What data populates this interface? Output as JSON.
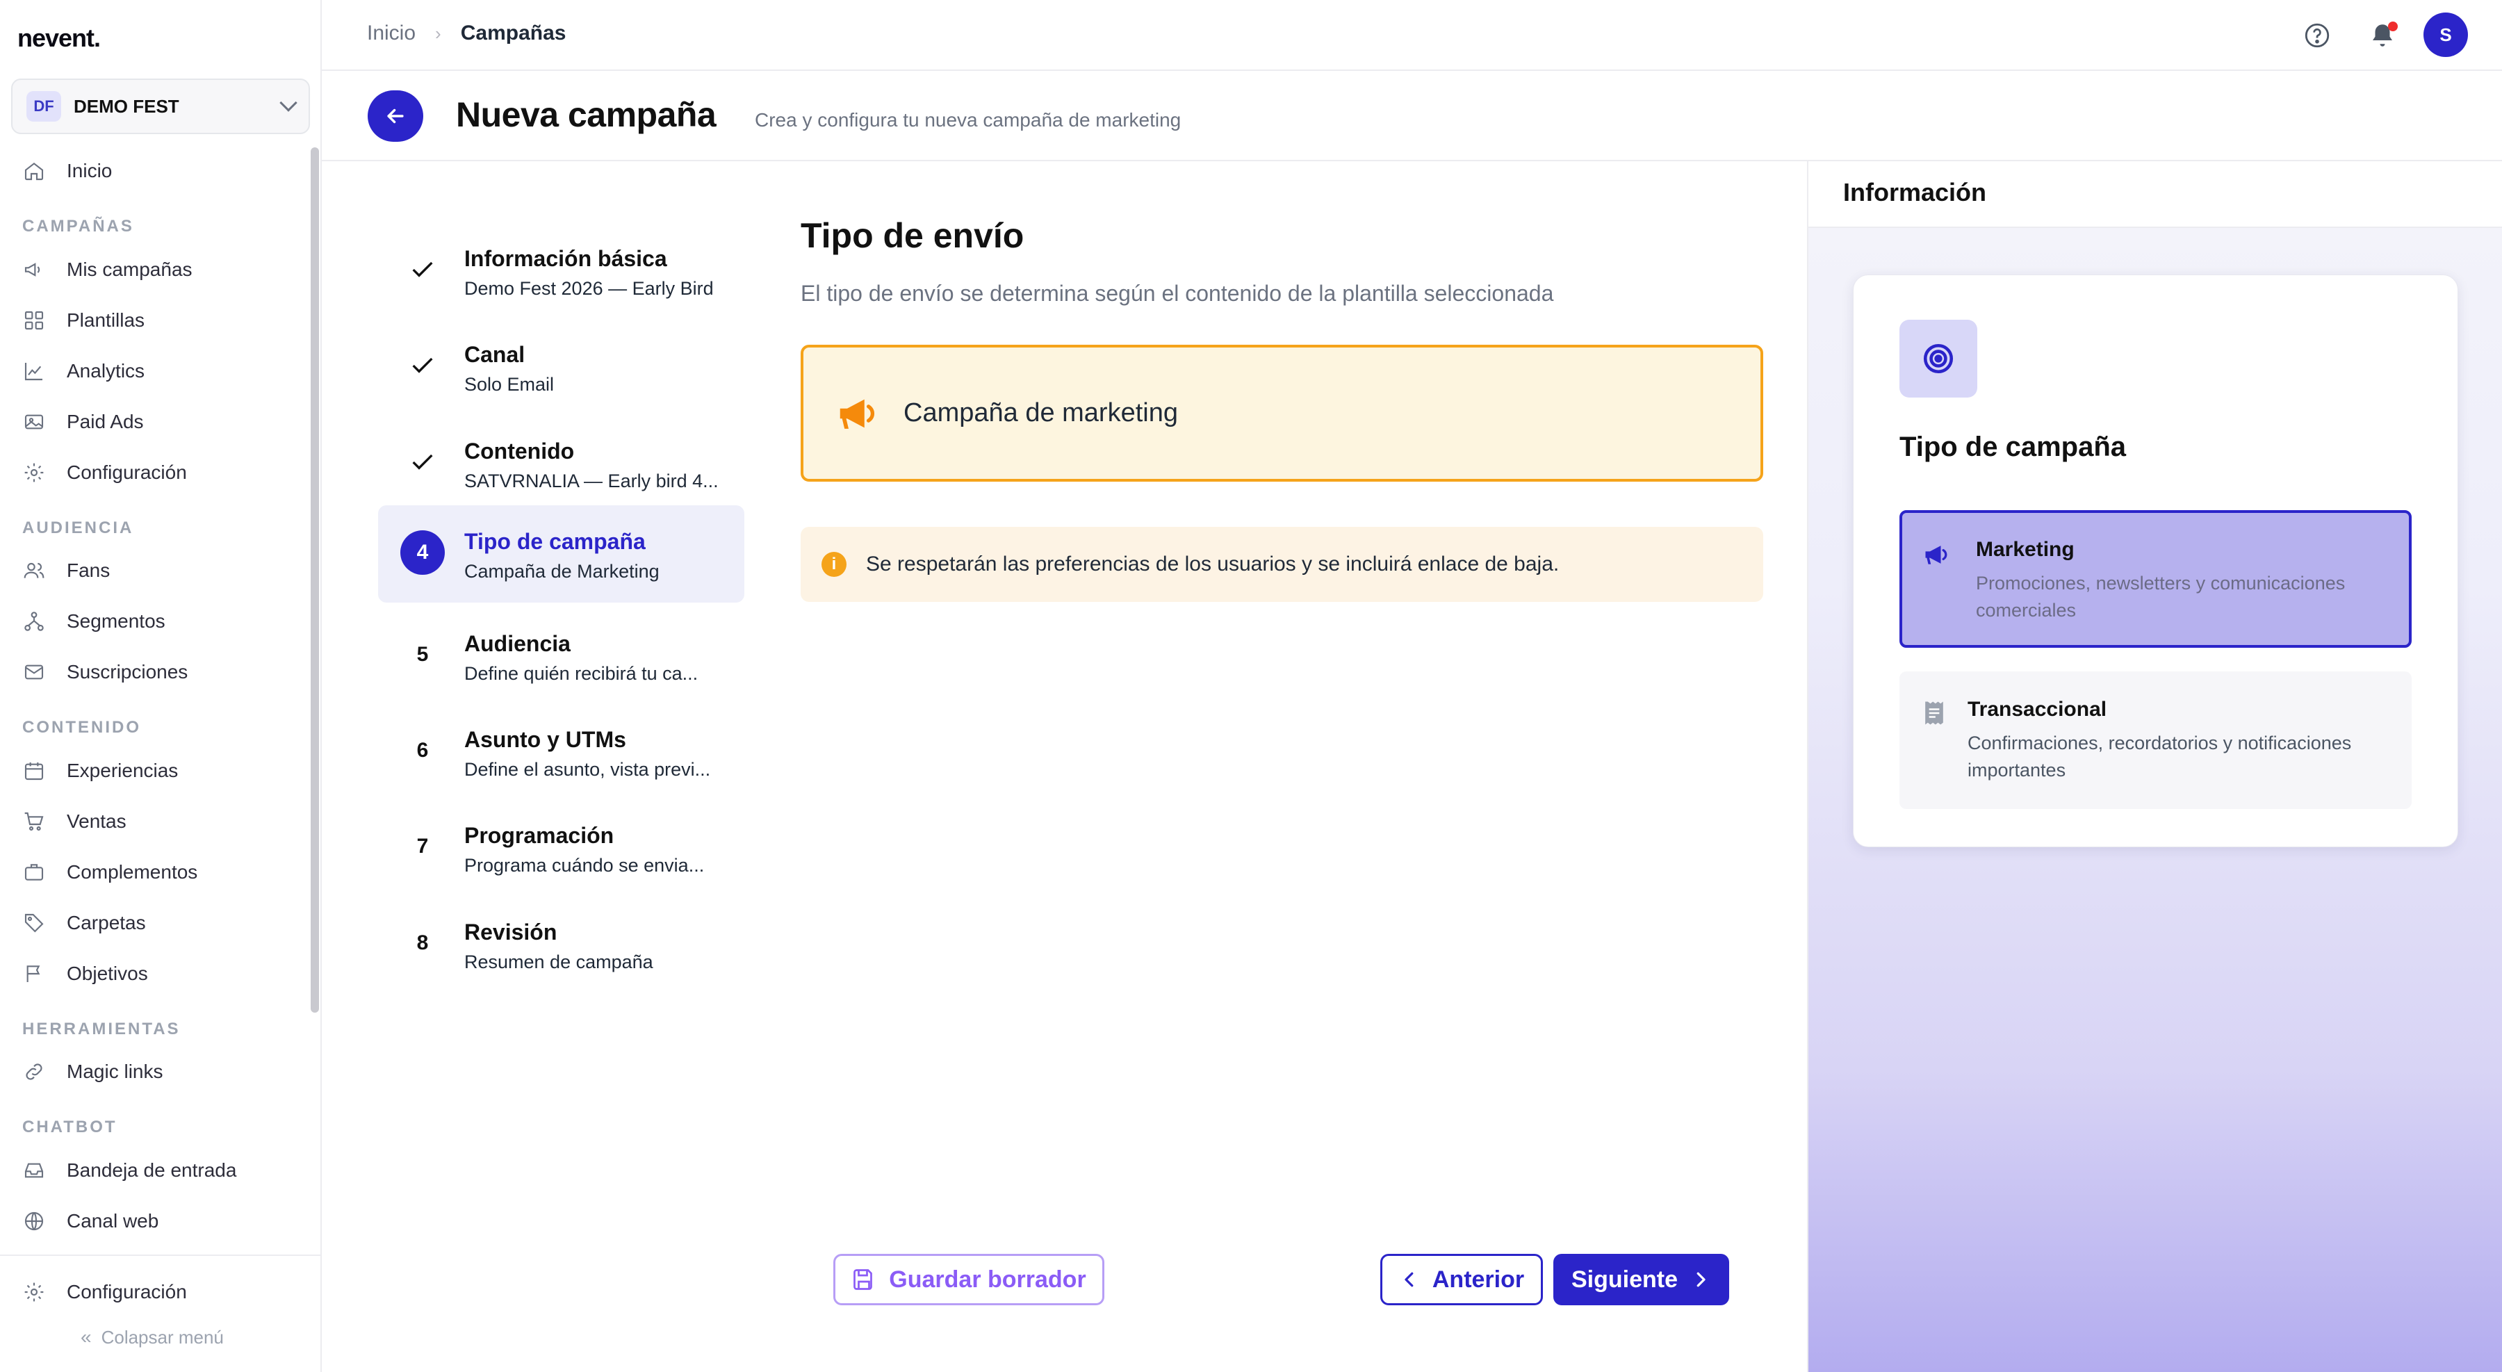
{
  "app": {
    "logo": "nevent."
  },
  "org": {
    "initials": "DF",
    "name": "DEMO FEST"
  },
  "sidebar": {
    "home": "Inicio",
    "sections": {
      "campaigns": "CAMPAÑAS",
      "audience": "AUDIENCIA",
      "content": "CONTENIDO",
      "tools": "HERRAMIENTAS",
      "chatbot": "CHATBOT"
    },
    "items": {
      "my_campaigns": "Mis campañas",
      "templates": "Plantillas",
      "analytics": "Analytics",
      "paid_ads": "Paid Ads",
      "config": "Configuración",
      "fans": "Fans",
      "segments": "Segmentos",
      "subscriptions": "Suscripciones",
      "experiences": "Experiencias",
      "sales": "Ventas",
      "addons": "Complementos",
      "folders": "Carpetas",
      "goals": "Objetivos",
      "magic_links": "Magic links",
      "inbox": "Bandeja de entrada",
      "web_channel": "Canal web"
    },
    "footer_config": "Configuración",
    "collapse": "Colapsar menú"
  },
  "breadcrumb": {
    "root": "Inicio",
    "current": "Campañas"
  },
  "user": {
    "initial": "S"
  },
  "header": {
    "title": "Nueva campaña",
    "subtitle": "Crea y configura tu nueva campaña de marketing"
  },
  "steps": [
    {
      "number": "1",
      "status": "done",
      "title": "Información básica",
      "desc": "Demo Fest 2026 — Early Bird"
    },
    {
      "number": "2",
      "status": "done",
      "title": "Canal",
      "desc": "Solo Email"
    },
    {
      "number": "3",
      "status": "done",
      "title": "Contenido",
      "desc": "SATVRNALIA — Early bird 4..."
    },
    {
      "number": "4",
      "status": "active",
      "title": "Tipo de campaña",
      "desc": "Campaña de Marketing"
    },
    {
      "number": "5",
      "status": "pending",
      "title": "Audiencia",
      "desc": "Define quién recibirá tu ca..."
    },
    {
      "number": "6",
      "status": "pending",
      "title": "Asunto y UTMs",
      "desc": "Define el asunto, vista previ..."
    },
    {
      "number": "7",
      "status": "pending",
      "title": "Programación",
      "desc": "Programa cuándo se envia..."
    },
    {
      "number": "8",
      "status": "pending",
      "title": "Revisión",
      "desc": "Resumen de campaña"
    }
  ],
  "main": {
    "title": "Tipo de envío",
    "subtitle": "El tipo de envío se determina según el contenido de la plantilla seleccionada",
    "type_label": "Campaña de marketing",
    "notice": "Se respetarán las preferencias de los usuarios y se incluirá enlace de baja."
  },
  "footer": {
    "draft": "Guardar borrador",
    "prev": "Anterior",
    "next": "Siguiente"
  },
  "info_panel": {
    "title": "Información",
    "card_title": "Tipo de campaña",
    "options": [
      {
        "title": "Marketing",
        "desc": "Promociones, newsletters y comunicaciones comerciales",
        "selected": true
      },
      {
        "title": "Transaccional",
        "desc": "Confirmaciones, recordatorios y notificaciones importantes",
        "selected": false
      }
    ]
  },
  "colors": {
    "primary": "#2b24c9",
    "warning": "#f5a31a",
    "draft": "#8b5cf6"
  }
}
